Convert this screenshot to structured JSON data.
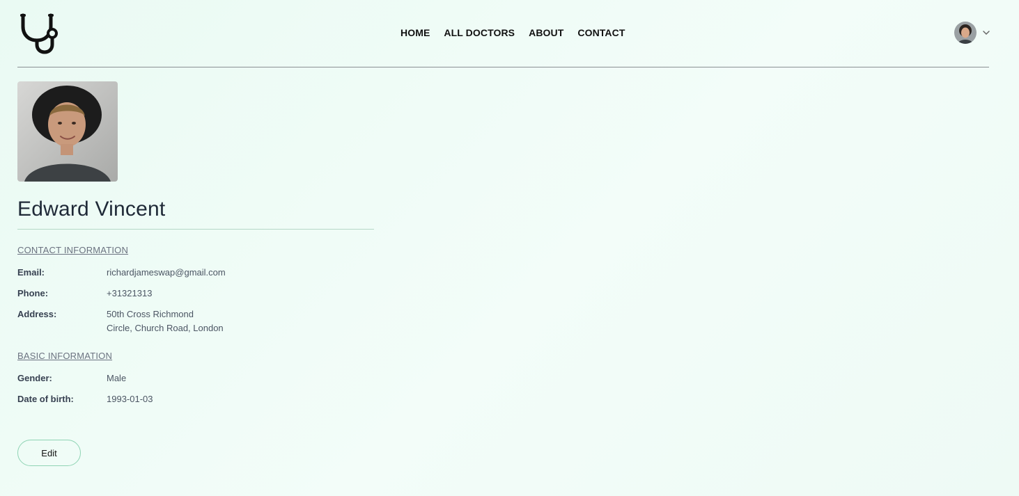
{
  "nav": {
    "logo_icon": "stethoscope-icon",
    "links": [
      "HOME",
      "ALL DOCTORS",
      "ABOUT",
      "CONTACT"
    ],
    "user_icon": "avatar",
    "dropdown_icon": "chevron-down-icon"
  },
  "profile": {
    "name": "Edward Vincent",
    "contact_section_title": "CONTACT INFORMATION",
    "email_label": "Email:",
    "email": "richardjameswap@gmail.com",
    "phone_label": "Phone:",
    "phone": "+31321313",
    "address_label": "Address:",
    "address_line1": "50th Cross Richmond",
    "address_line2": "Circle, Church Road, London",
    "basic_section_title": "BASIC INFORMATION",
    "gender_label": "Gender:",
    "gender": "Male",
    "dob_label": "Date of birth:",
    "dob": "1993-01-03"
  },
  "actions": {
    "edit_label": "Edit"
  },
  "colors": {
    "accent": "#8fd4b4",
    "background": "#eefaf5",
    "divider": "#b5d8c7"
  }
}
